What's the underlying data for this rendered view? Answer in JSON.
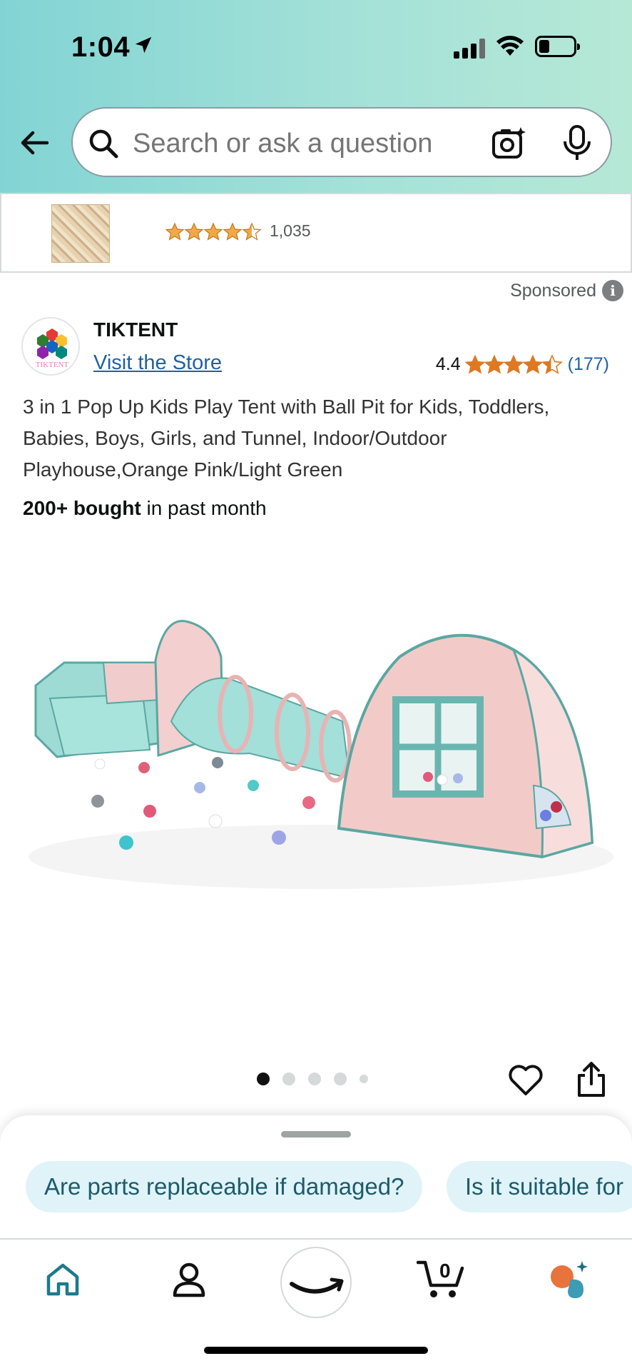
{
  "status_bar": {
    "time": "1:04"
  },
  "search": {
    "placeholder": "Search or ask a question"
  },
  "ad_banner": {
    "review_count": "1,035",
    "rating_stars": 4.5
  },
  "sponsored": {
    "label": "Sponsored"
  },
  "product": {
    "brand": "TIKTENT",
    "brand_logo_text": "TIKTENT",
    "visit_store": "Visit the Store",
    "rating": "4.4",
    "rating_count": "(177)",
    "title": "3 in 1 Pop Up Kids Play Tent with Ball Pit for Kids, Toddlers, Babies, Boys, Girls, and Tunnel, Indoor/Outdoor Playhouse,Orange Pink/Light Green",
    "bought_bold": "200+ bought",
    "bought_rest": " in past month"
  },
  "carousel": {
    "total_images": 5,
    "active_index": 0
  },
  "questions": [
    "Are parts replaceable if damaged?",
    "Is it suitable for"
  ],
  "nav": {
    "cart_count": "0"
  },
  "colors": {
    "accent_link": "#2162a1",
    "star": "#de7921",
    "chip_bg": "#dff3f8",
    "header_teal": "#82d4d4"
  }
}
